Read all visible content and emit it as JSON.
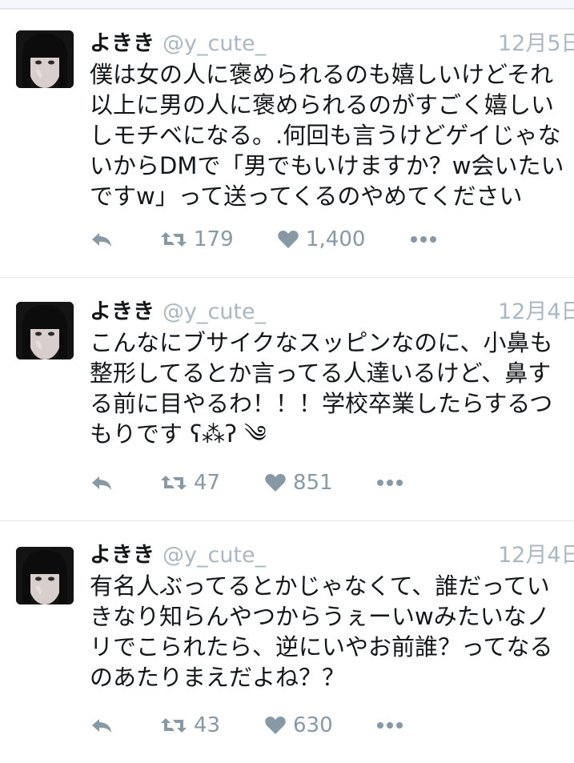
{
  "tweets": [
    {
      "name": "よきき",
      "handle": "@y_cute_",
      "date": "12月5日",
      "lines": [
        "僕は女の人に褒められるのも嬉しいけどそれ",
        "以上に男の人に褒められるのがすごく嬉しい",
        "しモチベになる。.何回も言うけどゲイじゃな",
        "いからDMで「男でもいけますか？w会いたい",
        "ですw」って送ってくるのやめてください"
      ],
      "retweets": "179",
      "likes": "1,400"
    },
    {
      "name": "よきき",
      "handle": "@y_cute_",
      "date": "12月4日",
      "lines": [
        "こんなにブサイクなスッピンなのに、小鼻も",
        "整形してるとか言ってる人達いるけど、鼻す",
        "る前に目やるわ！！！学校卒業したらするつ",
        "もりです ʕ⁂ʔ ༄"
      ],
      "retweets": "47",
      "likes": "851"
    },
    {
      "name": "よきき",
      "handle": "@y_cute_",
      "date": "12月4日",
      "lines": [
        "有名人ぶってるとかじゃなくて、誰だってい",
        "きなり知らんやつからうぇーいwみたいなノ",
        "リでこられたら、逆にいやお前誰？ってなる",
        "のあたりまえだよね？？"
      ],
      "retweets": "43",
      "likes": "630"
    }
  ],
  "icons": [
    "reply-icon",
    "retweet-icon",
    "like-icon",
    "more-icon"
  ],
  "colors": {
    "muted": "#aab8c2",
    "action": "#8899a6",
    "text": "#14171a",
    "border": "#e1e8ed"
  }
}
